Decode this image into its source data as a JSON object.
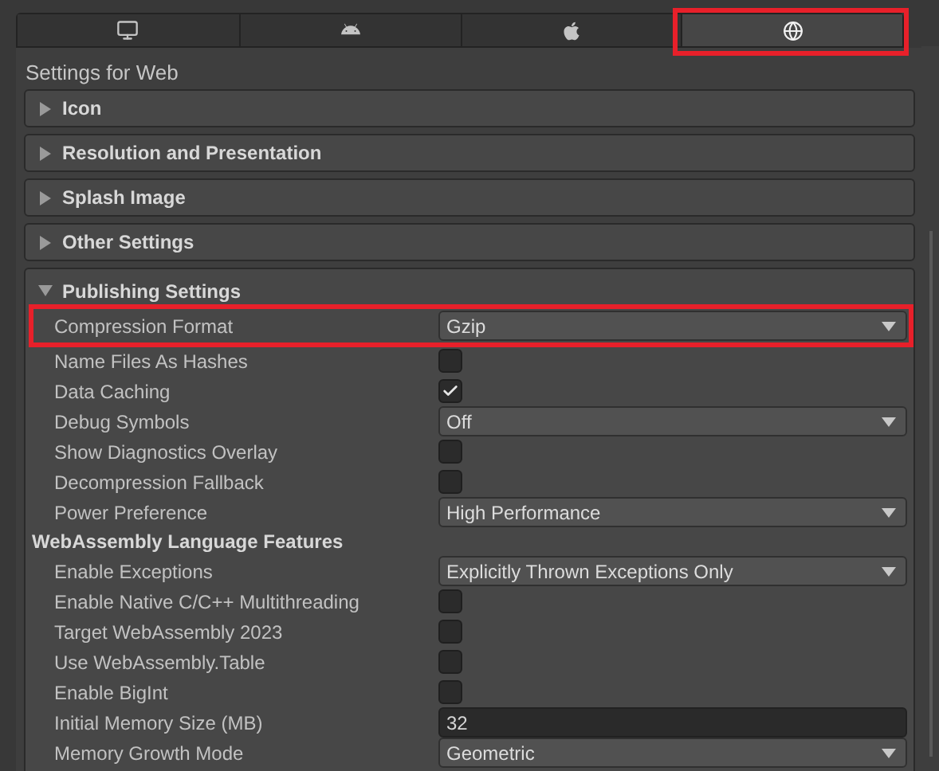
{
  "platform_tabs": [
    {
      "selected": false,
      "highlighted": false
    },
    {
      "selected": false,
      "highlighted": false
    },
    {
      "selected": false,
      "highlighted": false
    },
    {
      "selected": true,
      "highlighted": true
    }
  ],
  "title": "Settings for Web",
  "sections": [
    {
      "label": "Icon",
      "expanded": false
    },
    {
      "label": "Resolution and Presentation",
      "expanded": false
    },
    {
      "label": "Splash Image",
      "expanded": false
    },
    {
      "label": "Other Settings",
      "expanded": false
    }
  ],
  "publishing": {
    "label": "Publishing Settings",
    "expanded": true,
    "rows": [
      {
        "kind": "dropdown",
        "label": "Compression Format",
        "value": "Gzip",
        "highlighted": true
      },
      {
        "kind": "checkbox",
        "label": "Name Files As Hashes",
        "checked": false
      },
      {
        "kind": "checkbox",
        "label": "Data Caching",
        "checked": true
      },
      {
        "kind": "dropdown",
        "label": "Debug Symbols",
        "value": "Off"
      },
      {
        "kind": "checkbox",
        "label": "Show Diagnostics Overlay",
        "checked": false
      },
      {
        "kind": "checkbox",
        "label": "Decompression Fallback",
        "checked": false
      },
      {
        "kind": "dropdown",
        "label": "Power Preference",
        "value": "High Performance"
      },
      {
        "kind": "heading",
        "label": "WebAssembly Language Features"
      },
      {
        "kind": "dropdown",
        "label": "Enable Exceptions",
        "value": "Explicitly Thrown Exceptions Only"
      },
      {
        "kind": "checkbox",
        "label": "Enable Native C/C++ Multithreading",
        "checked": false
      },
      {
        "kind": "checkbox",
        "label": "Target WebAssembly 2023",
        "checked": false
      },
      {
        "kind": "checkbox",
        "label": "Use WebAssembly.Table",
        "checked": false
      },
      {
        "kind": "checkbox",
        "label": "Enable BigInt",
        "checked": false
      },
      {
        "kind": "number",
        "label": "Initial Memory Size (MB)",
        "value": "32"
      },
      {
        "kind": "dropdown",
        "label": "Memory Growth Mode",
        "value": "Geometric"
      }
    ]
  }
}
